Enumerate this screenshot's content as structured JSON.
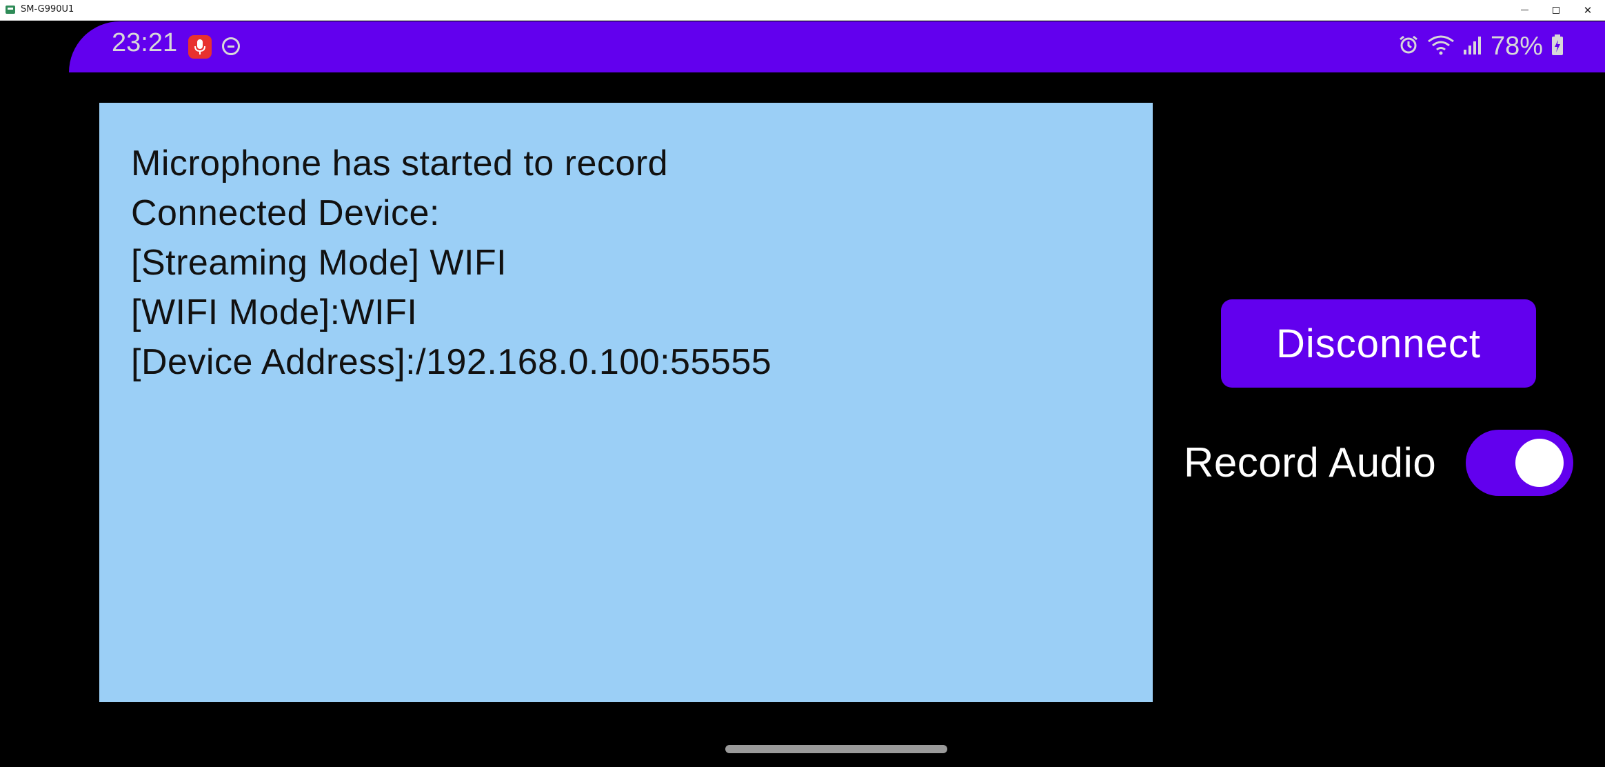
{
  "window": {
    "title": "SM-G990U1",
    "controls": {
      "minimize": "minimize",
      "maximize": "maximize",
      "close": "✕"
    }
  },
  "statusbar": {
    "time": "23:21",
    "battery_percent": "78%",
    "icons": [
      "mic-recording-icon",
      "do-not-disturb-icon",
      "alarm-icon",
      "wifi-icon",
      "signal-icon",
      "battery-charging-icon"
    ],
    "bar_color": "#6200ee"
  },
  "log": {
    "background_color": "#9bcff6",
    "lines": [
      "Microphone has started to record",
      "Connected Device:",
      "[Streaming Mode] WIFI",
      "[WIFI Mode]:WIFI",
      "[Device Address]:/192.168.0.100:55555"
    ]
  },
  "controls": {
    "disconnect_label": "Disconnect",
    "record_audio_label": "Record Audio",
    "record_audio_on": true,
    "accent_color": "#6200ee"
  }
}
